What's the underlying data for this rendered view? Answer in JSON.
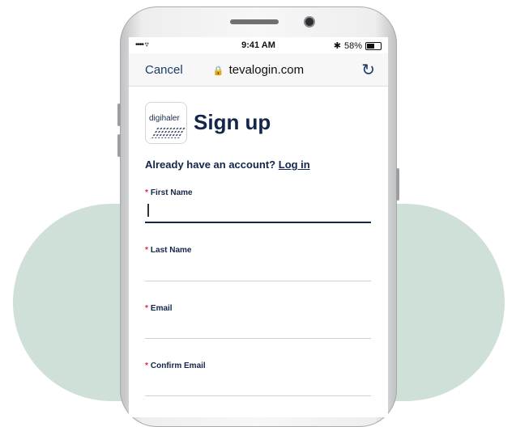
{
  "status": {
    "signal": "••••",
    "wifi": "▿",
    "time": "9:41 AM",
    "bluetooth": "✱",
    "battery": "58%",
    "battery_level": 0.58
  },
  "browser": {
    "cancel_label": "Cancel",
    "url": "tevalogin.com",
    "lock_icon": "lock-icon",
    "reload_icon": "reload-icon"
  },
  "brand": {
    "logo_text": "digihaler"
  },
  "page": {
    "title": "Sign up",
    "account_prompt": "Already have an account?",
    "login_link": "Log in",
    "required_mark": "*",
    "fields": [
      {
        "label": "First Name",
        "value": "",
        "active": true
      },
      {
        "label": "Last Name",
        "value": "",
        "active": false
      },
      {
        "label": "Email",
        "value": "",
        "active": false
      },
      {
        "label": "Confirm Email",
        "value": "",
        "active": false
      }
    ]
  },
  "colors": {
    "navy": "#13254a",
    "required": "#d32f3c",
    "backdrop": "#cfe0d8"
  }
}
